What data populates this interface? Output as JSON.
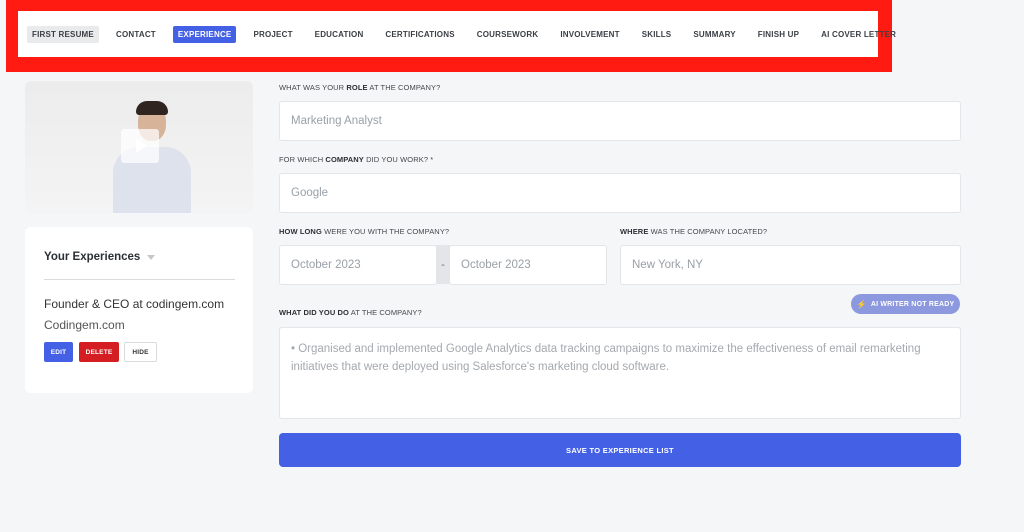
{
  "nav": {
    "items": [
      {
        "label": "FIRST RESUME"
      },
      {
        "label": "CONTACT"
      },
      {
        "label": "EXPERIENCE"
      },
      {
        "label": "PROJECT"
      },
      {
        "label": "EDUCATION"
      },
      {
        "label": "CERTIFICATIONS"
      },
      {
        "label": "COURSEWORK"
      },
      {
        "label": "INVOLVEMENT"
      },
      {
        "label": "SKILLS"
      },
      {
        "label": "SUMMARY"
      },
      {
        "label": "FINISH UP"
      },
      {
        "label": "AI COVER LETTER"
      }
    ],
    "active_index": 2
  },
  "sidebar": {
    "title": "Your Experiences",
    "entry": {
      "role": "Founder & CEO at codingem.com",
      "company": "Codingem.com",
      "edit": "EDIT",
      "delete": "DELETE",
      "hide": "HIDE"
    }
  },
  "form": {
    "role": {
      "label_pre": "WHAT WAS YOUR ",
      "label_bold": "ROLE",
      "label_post": " AT THE COMPANY?",
      "placeholder": "Marketing Analyst"
    },
    "company": {
      "label_pre": "FOR WHICH ",
      "label_bold": "COMPANY",
      "label_post": " DID YOU WORK?  *",
      "placeholder": "Google"
    },
    "duration": {
      "label_bold": "HOW LONG",
      "label_post": " WERE YOU WITH THE COMPANY?",
      "start_placeholder": "October 2023",
      "end_placeholder": "October 2023",
      "separator": "-"
    },
    "location": {
      "label_bold": "WHERE",
      "label_post": " WAS THE COMPANY LOCATED?",
      "placeholder": "New York, NY"
    },
    "duties": {
      "label_bold": "WHAT DID YOU DO",
      "label_post": " AT THE COMPANY?",
      "placeholder": "• Organised and implemented Google Analytics data tracking campaigns to maximize the effectiveness of email remarketing initiatives that were deployed using Salesforce's marketing cloud software."
    },
    "ai_writer": {
      "icon": "lightning-icon",
      "label": "AI WRITER NOT READY"
    },
    "save": "SAVE TO EXPERIENCE LIST"
  },
  "colors": {
    "accent": "#4461e6",
    "danger": "#d51e22",
    "highlight": "#ff1a12"
  }
}
